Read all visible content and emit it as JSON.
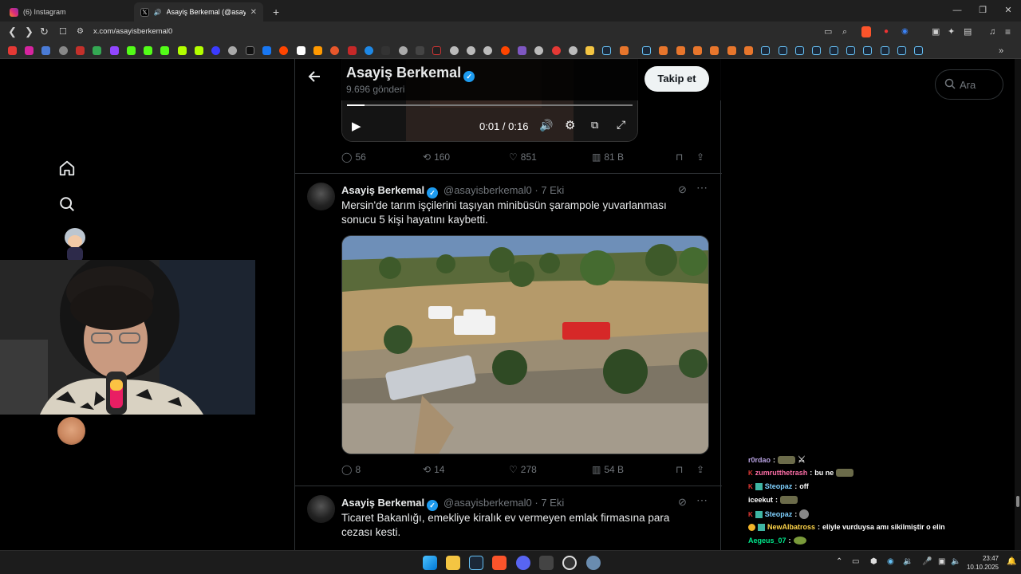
{
  "browser": {
    "tabs": [
      {
        "label": "(6) Instagram",
        "icon": "instagram-icon"
      },
      {
        "label": "Asayiş Berkemal (@asayisberi",
        "icon": "x-icon"
      }
    ],
    "new_tab": "+",
    "url": "x.com/asayisberkemal0"
  },
  "header": {
    "name": "Asayiş Berkemal",
    "post_count": "9.696 gönderi",
    "follow_label": "Takip et"
  },
  "search": {
    "placeholder": "Ara"
  },
  "video": {
    "time": "0:01 / 0:16",
    "progress": 0.0625
  },
  "tweets": [
    {
      "replies": "56",
      "reposts": "160",
      "likes": "851",
      "views": "81 B"
    },
    {
      "name": "Asayiş Berkemal",
      "handle": "@asayisberkemal0",
      "sep": "·",
      "date": "7 Eki",
      "text": "Mersin'de tarım işçilerini taşıyan minibüsün şarampole yuvarlanması sonucu 5 kişi hayatını kaybetti.",
      "replies": "8",
      "reposts": "14",
      "likes": "278",
      "views": "54 B"
    },
    {
      "name": "Asayiş Berkemal",
      "handle": "@asayisberkemal0",
      "sep": "·",
      "date": "7 Eki",
      "text": "Ticaret Bakanlığı, emekliye kiralık ev vermeyen emlak firmasına para cezası kesti."
    }
  ],
  "chat": [
    {
      "user": "r0rdao",
      "sep": ":",
      "msg": "",
      "color": "#b9a3e3"
    },
    {
      "user": "zumrutthetrash",
      "sep": ":",
      "msg": "bu ne",
      "color": "#ff6fa8"
    },
    {
      "user": "Steopaz",
      "sep": ":",
      "msg": "off",
      "color": "#7fd1ff"
    },
    {
      "user": "iceekut",
      "sep": ":",
      "msg": "",
      "color": "#ffffff"
    },
    {
      "user": "Steopaz",
      "sep": ":",
      "msg": "",
      "color": "#7fd1ff"
    },
    {
      "user": "NewAlbatross",
      "sep": ":",
      "msg": "eliyle vurduysa amı sikilmiştir o elin",
      "color": "#ffd54a"
    },
    {
      "user": "Aegeus_07",
      "sep": ":",
      "msg": "",
      "color": "#00e58a"
    }
  ],
  "clock": {
    "time": "23:47",
    "date": "10.10.2025"
  },
  "colors": {
    "accent": "#1d9bf0",
    "bg": "#000000",
    "muted": "#71767b"
  }
}
